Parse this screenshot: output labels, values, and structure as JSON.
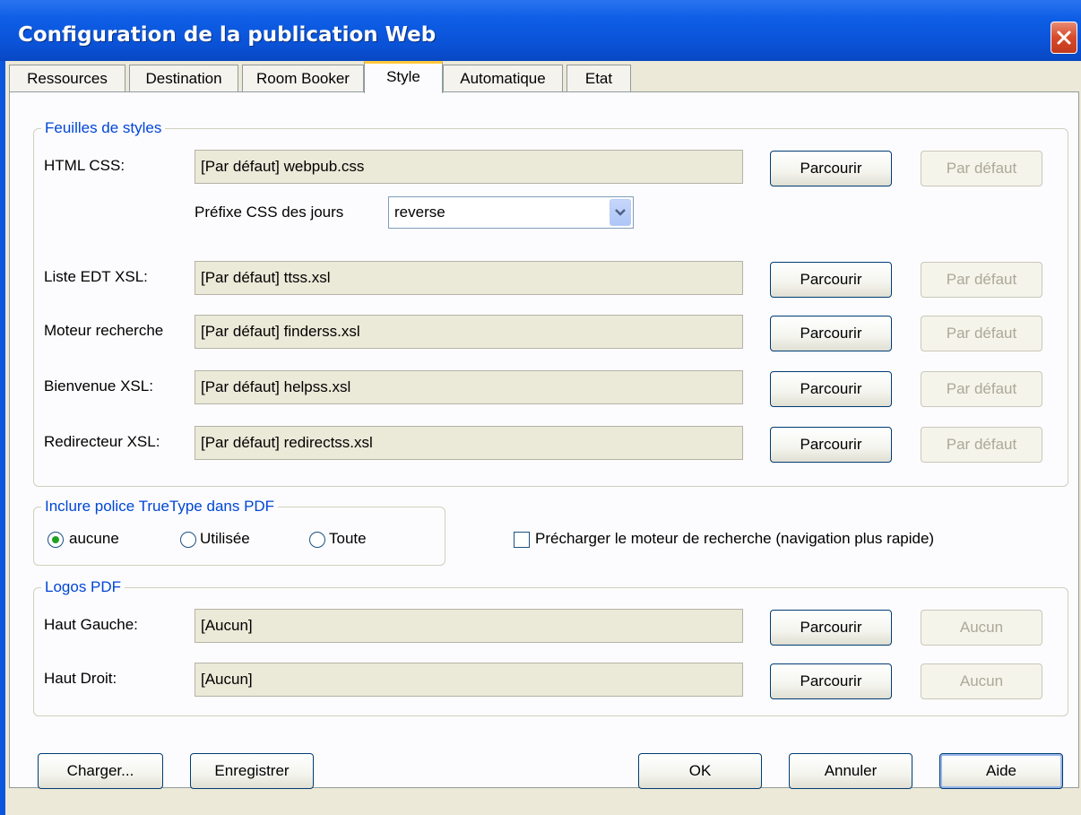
{
  "window": {
    "title": "Configuration de la publication Web"
  },
  "tabs": [
    {
      "label": "Ressources"
    },
    {
      "label": "Destination"
    },
    {
      "label": "Room Booker"
    },
    {
      "label": "Style",
      "active": true
    },
    {
      "label": "Automatique"
    },
    {
      "label": "Etat"
    }
  ],
  "stylesheets": {
    "group_label": "Feuilles de styles",
    "html_css": {
      "label": "HTML CSS:",
      "value": "[Par défaut] webpub.css",
      "browse": "Parcourir",
      "default": "Par défaut"
    },
    "prefix": {
      "label": "Préfixe CSS des jours",
      "value": "reverse"
    },
    "rows": [
      {
        "label": "Liste EDT XSL:",
        "value": "[Par défaut] ttss.xsl",
        "browse": "Parcourir",
        "default": "Par défaut"
      },
      {
        "label": "Moteur recherche",
        "value": "[Par défaut] finderss.xsl",
        "browse": "Parcourir",
        "default": "Par défaut"
      },
      {
        "label": "Bienvenue XSL:",
        "value": "[Par défaut] helpss.xsl",
        "browse": "Parcourir",
        "default": "Par défaut"
      },
      {
        "label": "Redirecteur XSL:",
        "value": "[Par défaut] redirectss.xsl",
        "browse": "Parcourir",
        "default": "Par défaut"
      }
    ]
  },
  "fonts": {
    "group_label": "Inclure police TrueType dans PDF",
    "options": [
      {
        "label": "aucune",
        "selected": true
      },
      {
        "label": "Utilisée",
        "selected": false
      },
      {
        "label": "Toute",
        "selected": false
      }
    ]
  },
  "preload": {
    "label": "Précharger le moteur de recherche (navigation plus rapide)",
    "checked": false
  },
  "logos": {
    "group_label": "Logos PDF",
    "rows": [
      {
        "label": "Haut Gauche:",
        "value": "[Aucun]",
        "browse": "Parcourir",
        "none": "Aucun"
      },
      {
        "label": "Haut Droit:",
        "value": "[Aucun]",
        "browse": "Parcourir",
        "none": "Aucun"
      }
    ]
  },
  "footer": {
    "load": "Charger...",
    "save": "Enregistrer",
    "ok": "OK",
    "cancel": "Annuler",
    "help": "Aide"
  },
  "colors": {
    "titlebar": "#0a56dc",
    "accent_label": "#0046d5",
    "active_tab_highlight": "#ffc83c",
    "radio_dot": "#21a121"
  }
}
